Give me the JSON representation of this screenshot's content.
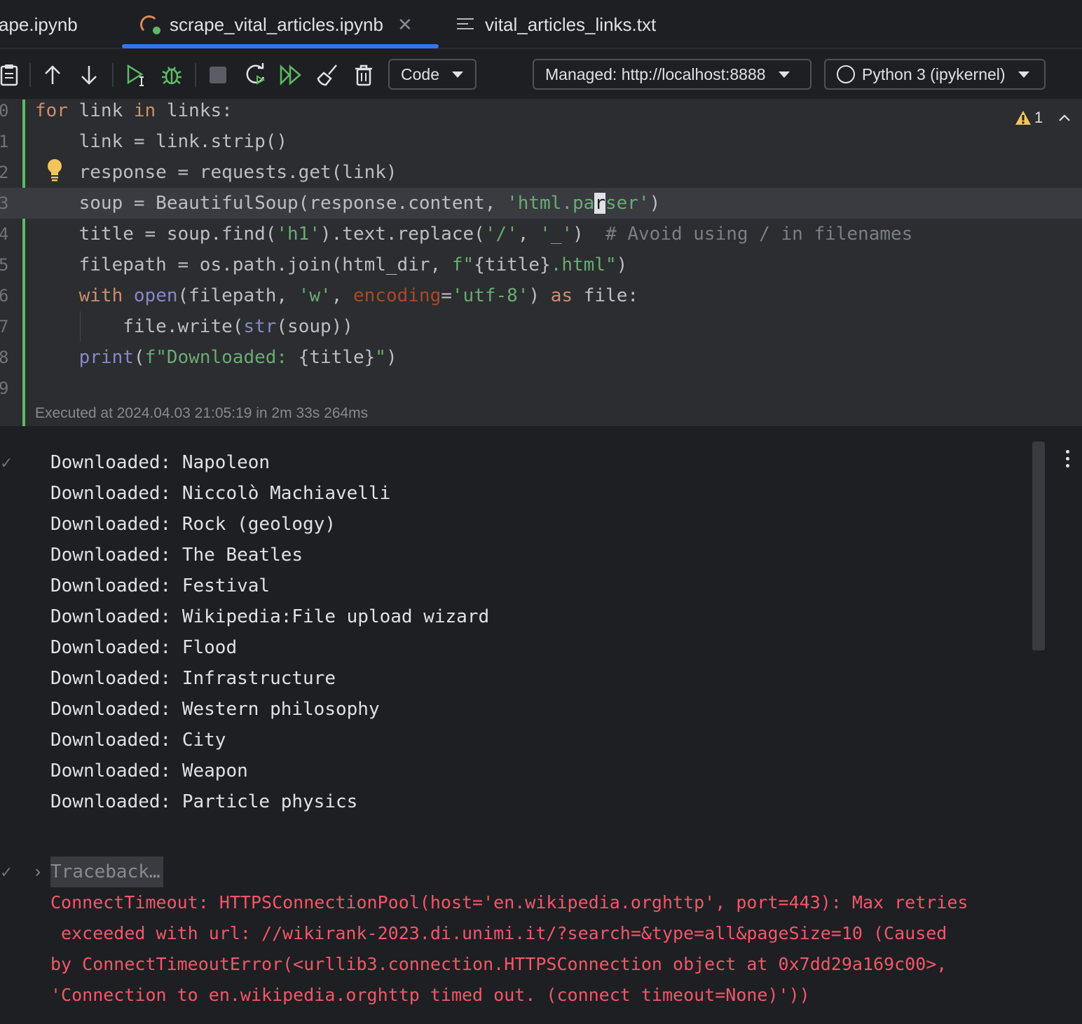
{
  "tabs": [
    {
      "label": "ape.ipynb"
    },
    {
      "label": "scrape_vital_articles.ipynb",
      "active": true
    },
    {
      "label": "vital_articles_links.txt"
    }
  ],
  "toolbar": {
    "cell_type": "Code",
    "server": "Managed: http://localhost:8888",
    "kernel": "Python 3 (ipykernel)",
    "icons": [
      "clipboard-icon",
      "move-up-icon",
      "move-down-icon",
      "run-cell-icon",
      "debug-icon",
      "stop-icon",
      "restart-icon",
      "run-all-icon",
      "clear-outputs-icon",
      "delete-icon"
    ]
  },
  "editor": {
    "line_numbers": [
      "0",
      "1",
      "2",
      "3",
      "4",
      "5",
      "6",
      "7",
      "8",
      "9"
    ],
    "warning_count": "1",
    "executed": "Executed at 2024.04.03 21:05:19 in 2m 33s 264ms"
  },
  "output": {
    "lines": [
      "Downloaded: Napoleon",
      "Downloaded: Niccolò Machiavelli",
      "Downloaded: Rock (geology)",
      "Downloaded: The Beatles",
      "Downloaded: Festival",
      "Downloaded: Wikipedia:File upload wizard",
      "Downloaded: Flood",
      "Downloaded: Infrastructure",
      "Downloaded: Western philosophy",
      "Downloaded: City",
      "Downloaded: Weapon",
      "Downloaded: Particle physics"
    ],
    "traceback_label": "Traceback…",
    "error_lines": [
      "ConnectTimeout: HTTPSConnectionPool(host='en.wikipedia.orghttp', port=443): Max retries",
      " exceeded with url: //wikirank-2023.di.unimi.it/?search=&type=all&pageSize=10 (Caused",
      "by ConnectTimeoutError(<urllib3.connection.HTTPSConnection object at 0x7dd29a169c00>,",
      "'Connection to en.wikipedia.orghttp timed out. (connect timeout=None)'))"
    ]
  },
  "colors": {
    "accent": "#3574f0",
    "success": "#5fb865",
    "error": "#f2576a",
    "keyword": "#cf8e6d",
    "string": "#6aab73"
  }
}
